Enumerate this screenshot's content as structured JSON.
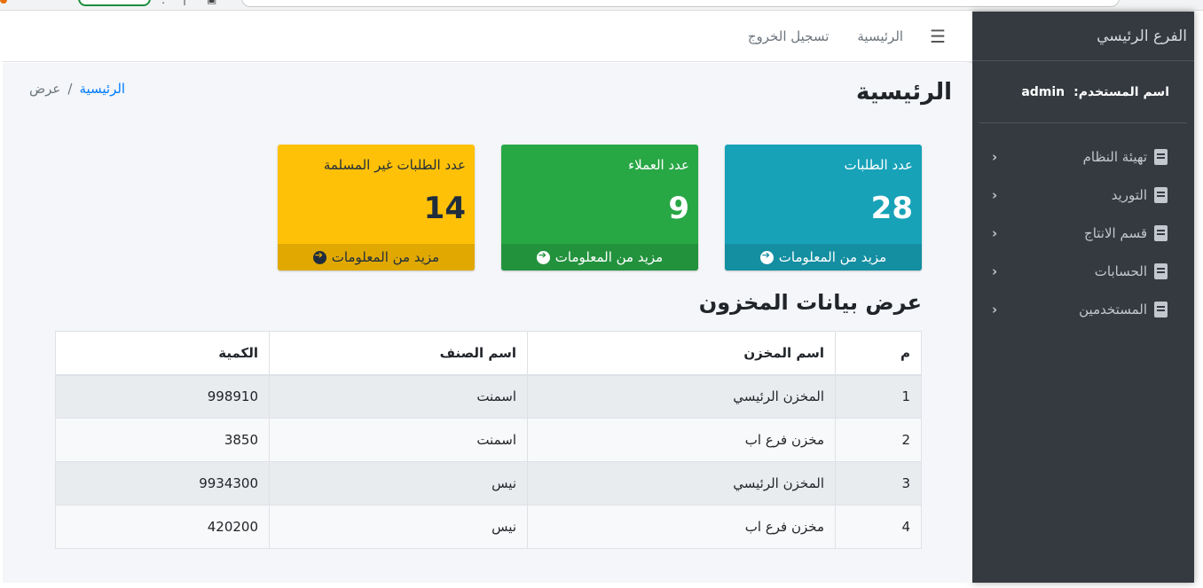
{
  "sidebar": {
    "brand": "الفرع الرئيسي",
    "user_label": "اسم المستخدم:",
    "user_name": "admin",
    "items": [
      {
        "label": "تهيئة النظام"
      },
      {
        "label": "التوريد"
      },
      {
        "label": "قسم الانتاج"
      },
      {
        "label": "الحسابات"
      },
      {
        "label": "المستخدمين"
      }
    ]
  },
  "topbar": {
    "home": "الرئيسية",
    "logout": "تسجيل الخروج"
  },
  "page": {
    "title": "الرئيسية"
  },
  "breadcrumb": {
    "home": "الرئيسية",
    "sep": "/",
    "current": "عرض"
  },
  "cards": [
    {
      "label": "عدد الطلبات",
      "value": "28",
      "more": "مزيد من المعلومات",
      "color": "#17a2b8"
    },
    {
      "label": "عدد العملاء",
      "value": "9",
      "more": "مزيد من المعلومات",
      "color": "#28a745"
    },
    {
      "label": "عدد الطلبات غير المسلمة",
      "value": "14",
      "more": "مزيد من المعلومات",
      "color": "#ffc107"
    }
  ],
  "inventory": {
    "title": "عرض بيانات المخزون",
    "headers": {
      "m": "م",
      "store": "اسم المخزن",
      "item": "اسم الصنف",
      "qty": "الكمية"
    },
    "rows": [
      {
        "m": "1",
        "store": "المخزن الرئيسي",
        "item": "اسمنت",
        "qty": "998910"
      },
      {
        "m": "2",
        "store": "مخزن فرع اب",
        "item": "اسمنت",
        "qty": "3850"
      },
      {
        "m": "3",
        "store": "المخزن الرئيسي",
        "item": "نيس",
        "qty": "9934300"
      },
      {
        "m": "4",
        "store": "مخزن فرع اب",
        "item": "نيس",
        "qty": "420200"
      }
    ]
  }
}
